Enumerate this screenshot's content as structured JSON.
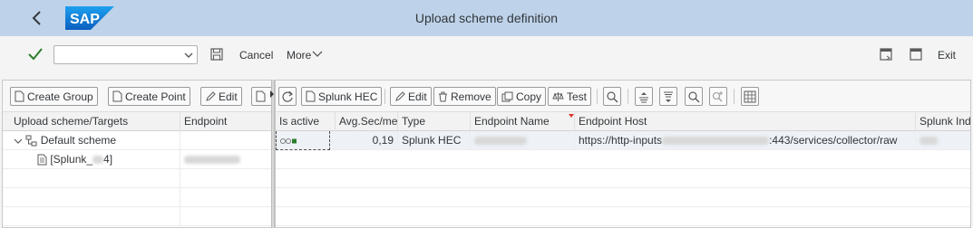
{
  "shell": {
    "title": "Upload scheme definition",
    "logo_text": "SAP",
    "back_icon": "back-icon"
  },
  "toolbar": {
    "command_value": "",
    "cancel_label": "Cancel",
    "more_label": "More"
  },
  "exit_label": "Exit",
  "left_panel": {
    "buttons": {
      "create_group": "Create Group",
      "create_point": "Create Point",
      "edit": "Edit"
    },
    "columns": [
      "Upload scheme/Targets",
      "Endpoint"
    ],
    "tree": {
      "root": "Default scheme",
      "child_prefix": "[Splunk_",
      "child_suffix": "4]"
    }
  },
  "right_panel": {
    "buttons": {
      "splunk_hec": "Splunk HEC",
      "edit": "Edit",
      "remove": "Remove",
      "copy": "Copy",
      "test": "Test"
    },
    "columns": [
      "Is active",
      "Avg.Sec/me",
      "Type",
      "Endpoint Name",
      "Endpoint Host",
      "Splunk Ind"
    ],
    "row": {
      "avg": "0,19",
      "type": "Splunk HEC",
      "host_prefix": "https://http-inputs",
      "host_suffix": ":443/services/collector/raw"
    }
  },
  "colors": {
    "shell_bg": "#bed3ea",
    "accent_green": "#2b7d2b",
    "sap_blue": "#0a6ed1"
  }
}
